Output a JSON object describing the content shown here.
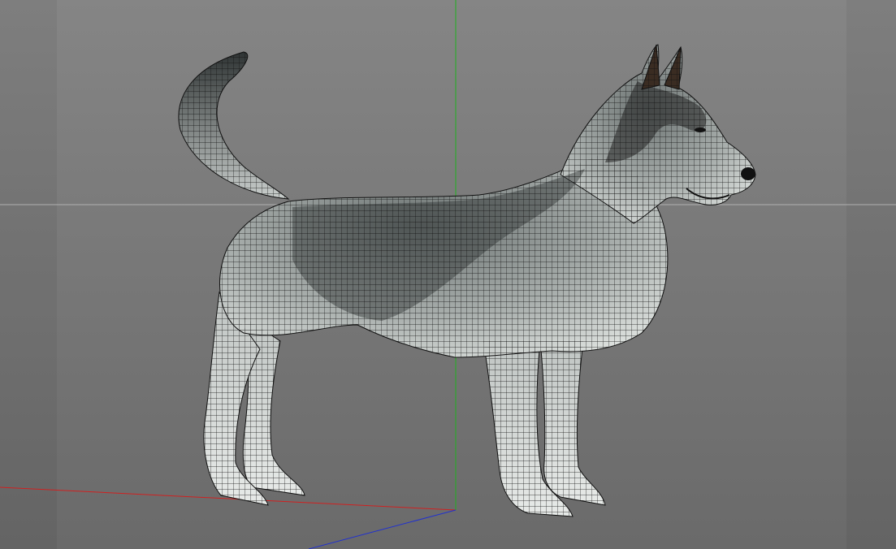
{
  "viewport": {
    "background_top": "#858585",
    "background_bottom": "#6a6a6a",
    "axis_colors": {
      "x": "#d02020",
      "y": "#20b020",
      "z": "#2030d0",
      "horizon": "#b0b0b0"
    }
  },
  "model": {
    "icon": "husky-mesh-model",
    "wire_color": "#111111",
    "coat_light": "#d8dcd8",
    "coat_dark": "#2e3233",
    "coat_mid": "#7d8584"
  }
}
